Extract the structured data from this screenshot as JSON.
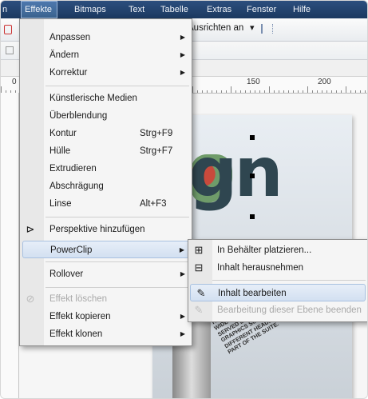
{
  "menubar": {
    "items": [
      {
        "label": "n"
      },
      {
        "label": "Effekte"
      },
      {
        "label": "Bitmaps"
      },
      {
        "label": "Text"
      },
      {
        "label": "Tabelle"
      },
      {
        "label": "Extras"
      },
      {
        "label": "Fenster"
      },
      {
        "label": "Hilfe"
      }
    ]
  },
  "toolbar": {
    "align_label": "Ausrichten an",
    "dropdown_arrow": "▾"
  },
  "ruler": {
    "labels": [
      "0",
      "150",
      "200"
    ]
  },
  "effekte_menu": {
    "items": [
      {
        "label": "Anpassen",
        "shortcut": "",
        "submenu": true
      },
      {
        "label": "Ändern",
        "shortcut": "",
        "submenu": true
      },
      {
        "label": "Korrektur",
        "shortcut": "",
        "submenu": true
      },
      {
        "label": "Künstlerische Medien",
        "shortcut": ""
      },
      {
        "label": "Überblendung",
        "shortcut": ""
      },
      {
        "label": "Kontur",
        "shortcut": "Strg+F9"
      },
      {
        "label": "Hülle",
        "shortcut": "Strg+F7"
      },
      {
        "label": "Extrudieren",
        "shortcut": ""
      },
      {
        "label": "Abschrägung",
        "shortcut": ""
      },
      {
        "label": "Linse",
        "shortcut": "Alt+F3"
      },
      {
        "label": "Perspektive hinzufügen",
        "shortcut": ""
      },
      {
        "label": "PowerClip",
        "shortcut": "",
        "submenu": true
      },
      {
        "label": "Rollover",
        "shortcut": "",
        "submenu": true
      },
      {
        "label": "Effekt löschen",
        "shortcut": "",
        "disabled": true
      },
      {
        "label": "Effekt kopieren",
        "shortcut": "",
        "submenu": true
      },
      {
        "label": "Effekt klonen",
        "shortcut": "",
        "submenu": true
      }
    ]
  },
  "powerclip_menu": {
    "items": [
      {
        "label": "In Behälter platzieren..."
      },
      {
        "label": "Inhalt herausnehmen"
      },
      {
        "label": "Inhalt bearbeiten"
      },
      {
        "label": "Bearbeitung dieser Ebene beenden",
        "disabled": true
      }
    ]
  },
  "canvas": {
    "big_text": "gn",
    "rotated_text": "THE CAREFUL PR... AMOUNT OF TIME... WIDE RANGE OF USES IN... WHICH ARE SERVED BY THE COM... COREL DRAW GRAPHICS SUITE AS... WE USE DIFFERENT HEADLINES FOR EACH PART OF THE SUITE."
  },
  "colors": {
    "menubar": "#1b3960",
    "highlight": "#d3e0f1",
    "highlight_border": "#a8c1e0"
  }
}
